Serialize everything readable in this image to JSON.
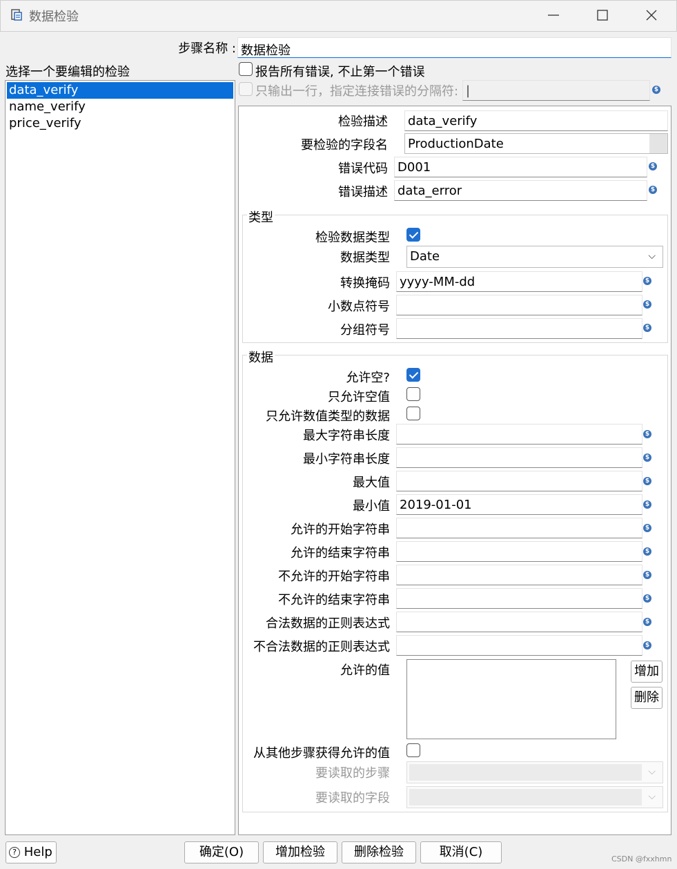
{
  "window": {
    "title": "数据检验",
    "minimize_icon": "minimize-icon",
    "maximize_icon": "maximize-icon",
    "close_icon": "close-icon"
  },
  "step_name": {
    "label": "步骤名称 :",
    "value": "数据检验"
  },
  "left": {
    "header": "选择一个要编辑的检验",
    "items": [
      "data_verify",
      "name_verify",
      "price_verify"
    ],
    "selected_index": 0
  },
  "options": {
    "report_all": {
      "label": "报告所有错误, 不止第一个错误",
      "checked": false
    },
    "single_row": {
      "label": "只输出一行，指定连接错误的分隔符:",
      "checked": false,
      "disabled": true,
      "value": "|"
    }
  },
  "detail": {
    "check_desc": {
      "label": "检验描述",
      "value": "data_verify"
    },
    "field_name": {
      "label": "要检验的字段名",
      "value": "ProductionDate"
    },
    "error_code": {
      "label": "错误代码",
      "value": "D001"
    },
    "error_desc": {
      "label": "错误描述",
      "value": "data_error"
    }
  },
  "type_group": {
    "title": "类型",
    "check_type": {
      "label": "检验数据类型",
      "checked": true
    },
    "data_type": {
      "label": "数据类型",
      "value": "Date"
    },
    "conversion_mask": {
      "label": "转换掩码",
      "value": "yyyy-MM-dd"
    },
    "decimal_symbol": {
      "label": "小数点符号",
      "value": ""
    },
    "grouping_symbol": {
      "label": "分组符号",
      "value": ""
    }
  },
  "data_group": {
    "title": "数据",
    "allow_null": {
      "label": "允许空?",
      "checked": true
    },
    "only_null": {
      "label": "只允许空值",
      "checked": false
    },
    "only_numeric": {
      "label": "只允许数值类型的数据",
      "checked": false
    },
    "fields": [
      {
        "label": "最大字符串长度",
        "value": ""
      },
      {
        "label": "最小字符串长度",
        "value": ""
      },
      {
        "label": "最大值",
        "value": ""
      },
      {
        "label": "最小值",
        "value": "2019-01-01"
      },
      {
        "label": "允许的开始字符串",
        "value": ""
      },
      {
        "label": "允许的结束字符串",
        "value": ""
      },
      {
        "label": "不允许的开始字符串",
        "value": ""
      },
      {
        "label": "不允许的结束字符串",
        "value": ""
      },
      {
        "label": "合法数据的正则表达式",
        "value": ""
      },
      {
        "label": "不合法数据的正则表达式",
        "value": ""
      }
    ],
    "allowed_values": {
      "label": "允许的值",
      "add": "增加",
      "delete": "删除"
    },
    "from_other_step": {
      "label": "从其他步骤获得允许的值",
      "checked": false
    },
    "read_step": {
      "label": "要读取的步骤",
      "value": ""
    },
    "read_field": {
      "label": "要读取的字段",
      "value": ""
    }
  },
  "footer": {
    "help": "Help",
    "ok": "确定(O)",
    "add_check": "增加检验",
    "delete_check": "删除检验",
    "cancel": "取消(C)",
    "watermark": "CSDN @fxxhmn"
  },
  "colors": {
    "accent": "#0a6fd8",
    "checkbox": "#1f6fd1",
    "variable_icon": "#3b73b9"
  }
}
